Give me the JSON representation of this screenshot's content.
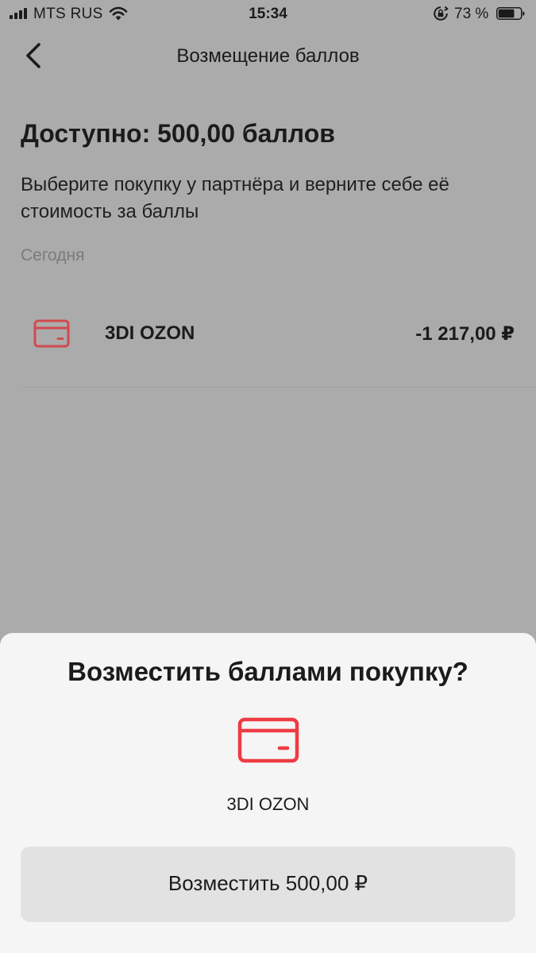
{
  "status_bar": {
    "carrier": "MTS RUS",
    "time": "15:34",
    "battery_percent": "73 %",
    "battery_level": 0.73,
    "signal_icon": "signal-bars-icon",
    "wifi_icon": "wifi-icon",
    "rotation_lock_icon": "rotation-lock-icon",
    "battery_icon": "battery-icon"
  },
  "nav": {
    "back_icon": "chevron-left-icon",
    "title": "Возмещение баллов"
  },
  "main": {
    "available": "Доступно: 500,00 баллов",
    "description": "Выберите покупку у партнёра и верните себе её стоимость за баллы",
    "section_date": "Сегодня",
    "purchases": [
      {
        "icon": "credit-card-icon",
        "merchant": "3DI OZON",
        "amount": "-1 217,00 ₽"
      }
    ]
  },
  "sheet": {
    "title": "Возместить баллами покупку?",
    "icon": "credit-card-icon",
    "merchant": "3DI OZON",
    "confirm_label": "Возместить 500,00 ₽"
  },
  "colors": {
    "dimmed_background": "#ababab",
    "sheet_background": "#f5f5f5",
    "button_background": "#e2e2e2",
    "accent_red": "#ef3b43",
    "accent_red_dimmed": "#d24a4f"
  }
}
